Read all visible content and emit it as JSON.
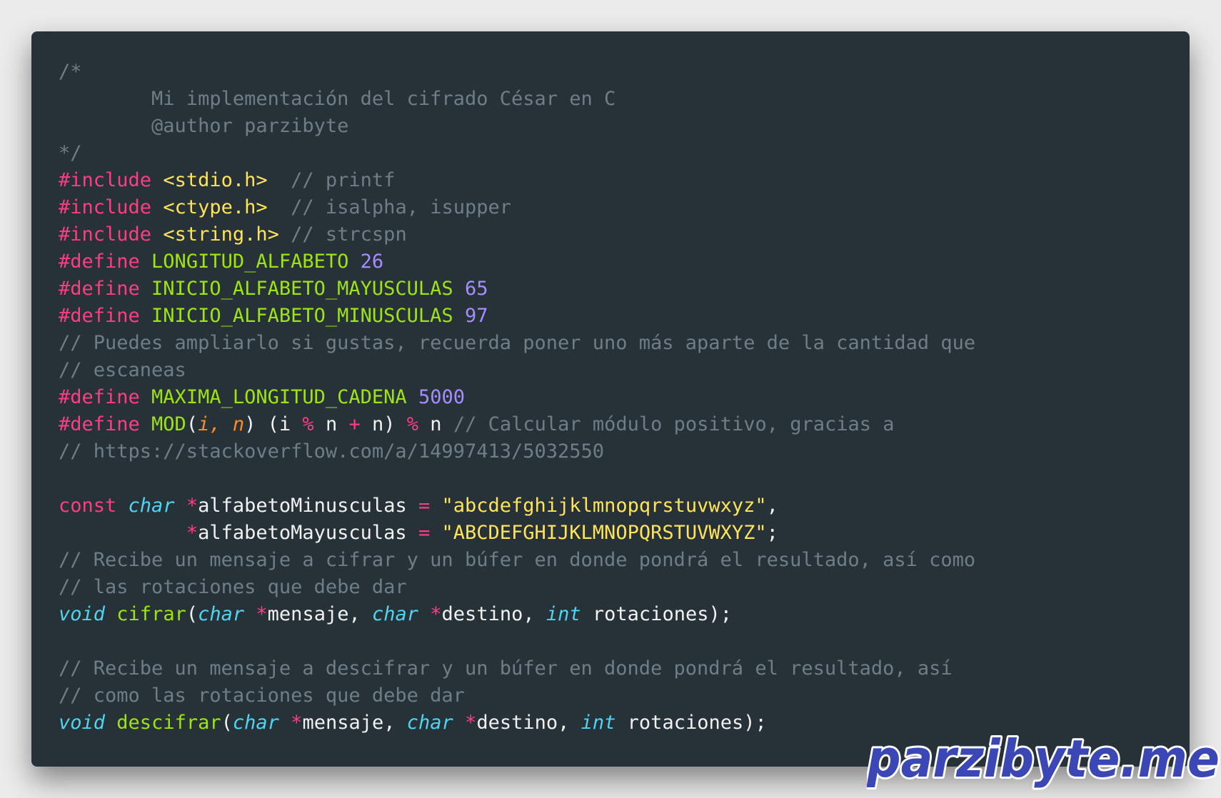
{
  "watermark": {
    "text": "parzibyte.me",
    "colors": {
      "fill": "#3a47b5",
      "stroke": "#ffffff"
    }
  },
  "editor": {
    "background": "#263238",
    "lines": [
      {
        "tokens": [
          {
            "t": "comment",
            "v": "/*"
          }
        ]
      },
      {
        "tokens": [
          {
            "t": "comment",
            "v": "        Mi implementación del cifrado César en C"
          }
        ]
      },
      {
        "tokens": [
          {
            "t": "comment",
            "v": "        @author parzibyte"
          }
        ]
      },
      {
        "tokens": [
          {
            "t": "comment",
            "v": "*/"
          }
        ]
      },
      {
        "tokens": [
          {
            "t": "preproc",
            "v": "#include "
          },
          {
            "t": "header",
            "v": "<stdio.h>"
          },
          {
            "t": "plain",
            "v": "  "
          },
          {
            "t": "comment",
            "v": "// printf"
          }
        ]
      },
      {
        "tokens": [
          {
            "t": "preproc",
            "v": "#include "
          },
          {
            "t": "header",
            "v": "<ctype.h>"
          },
          {
            "t": "plain",
            "v": "  "
          },
          {
            "t": "comment",
            "v": "// isalpha, isupper"
          }
        ]
      },
      {
        "tokens": [
          {
            "t": "preproc",
            "v": "#include "
          },
          {
            "t": "header",
            "v": "<string.h>"
          },
          {
            "t": "plain",
            "v": " "
          },
          {
            "t": "comment",
            "v": "// strcspn"
          }
        ]
      },
      {
        "tokens": [
          {
            "t": "preproc",
            "v": "#define "
          },
          {
            "t": "macro",
            "v": "LONGITUD_ALFABETO"
          },
          {
            "t": "plain",
            "v": " "
          },
          {
            "t": "number",
            "v": "26"
          }
        ]
      },
      {
        "tokens": [
          {
            "t": "preproc",
            "v": "#define "
          },
          {
            "t": "macro",
            "v": "INICIO_ALFABETO_MAYUSCULAS"
          },
          {
            "t": "plain",
            "v": " "
          },
          {
            "t": "number",
            "v": "65"
          }
        ]
      },
      {
        "tokens": [
          {
            "t": "preproc",
            "v": "#define "
          },
          {
            "t": "macro",
            "v": "INICIO_ALFABETO_MINUSCULAS"
          },
          {
            "t": "plain",
            "v": " "
          },
          {
            "t": "number",
            "v": "97"
          }
        ]
      },
      {
        "tokens": [
          {
            "t": "comment",
            "v": "// Puedes ampliarlo si gustas, recuerda poner uno más aparte de la cantidad que"
          }
        ]
      },
      {
        "tokens": [
          {
            "t": "comment",
            "v": "// escaneas"
          }
        ]
      },
      {
        "tokens": [
          {
            "t": "preproc",
            "v": "#define "
          },
          {
            "t": "macro",
            "v": "MAXIMA_LONGITUD_CADENA"
          },
          {
            "t": "plain",
            "v": " "
          },
          {
            "t": "number",
            "v": "5000"
          }
        ]
      },
      {
        "tokens": [
          {
            "t": "preproc",
            "v": "#define "
          },
          {
            "t": "macro",
            "v": "MOD"
          },
          {
            "t": "paren",
            "v": "("
          },
          {
            "t": "param",
            "v": "i, n"
          },
          {
            "t": "paren",
            "v": ")"
          },
          {
            "t": "plain",
            "v": " (i "
          },
          {
            "t": "op",
            "v": "%"
          },
          {
            "t": "plain",
            "v": " n "
          },
          {
            "t": "op",
            "v": "+"
          },
          {
            "t": "plain",
            "v": " n) "
          },
          {
            "t": "op",
            "v": "%"
          },
          {
            "t": "plain",
            "v": " n "
          },
          {
            "t": "comment",
            "v": "// Calcular módulo positivo, gracias a"
          }
        ]
      },
      {
        "tokens": [
          {
            "t": "comment",
            "v": "// https://stackoverflow.com/a/14997413/5032550"
          }
        ]
      },
      {
        "tokens": []
      },
      {
        "tokens": [
          {
            "t": "keyword",
            "v": "const"
          },
          {
            "t": "plain",
            "v": " "
          },
          {
            "t": "type",
            "v": "char"
          },
          {
            "t": "plain",
            "v": " "
          },
          {
            "t": "op",
            "v": "*"
          },
          {
            "t": "ident",
            "v": "alfabetoMinusculas"
          },
          {
            "t": "plain",
            "v": " "
          },
          {
            "t": "op",
            "v": "="
          },
          {
            "t": "plain",
            "v": " "
          },
          {
            "t": "string",
            "v": "\"abcdefghijklmnopqrstuvwxyz\""
          },
          {
            "t": "plain",
            "v": ","
          }
        ]
      },
      {
        "tokens": [
          {
            "t": "plain",
            "v": "           "
          },
          {
            "t": "op",
            "v": "*"
          },
          {
            "t": "ident",
            "v": "alfabetoMayusculas"
          },
          {
            "t": "plain",
            "v": " "
          },
          {
            "t": "op",
            "v": "="
          },
          {
            "t": "plain",
            "v": " "
          },
          {
            "t": "string",
            "v": "\"ABCDEFGHIJKLMNOPQRSTUVWXYZ\""
          },
          {
            "t": "plain",
            "v": ";"
          }
        ]
      },
      {
        "tokens": [
          {
            "t": "comment",
            "v": "// Recibe un mensaje a cifrar y un búfer en donde pondrá el resultado, así como"
          }
        ]
      },
      {
        "tokens": [
          {
            "t": "comment",
            "v": "// las rotaciones que debe dar"
          }
        ]
      },
      {
        "tokens": [
          {
            "t": "type",
            "v": "void"
          },
          {
            "t": "plain",
            "v": " "
          },
          {
            "t": "func",
            "v": "cifrar"
          },
          {
            "t": "paren",
            "v": "("
          },
          {
            "t": "type",
            "v": "char"
          },
          {
            "t": "plain",
            "v": " "
          },
          {
            "t": "op",
            "v": "*"
          },
          {
            "t": "ident",
            "v": "mensaje"
          },
          {
            "t": "plain",
            "v": ", "
          },
          {
            "t": "type",
            "v": "char"
          },
          {
            "t": "plain",
            "v": " "
          },
          {
            "t": "op",
            "v": "*"
          },
          {
            "t": "ident",
            "v": "destino"
          },
          {
            "t": "plain",
            "v": ", "
          },
          {
            "t": "type",
            "v": "int"
          },
          {
            "t": "plain",
            "v": " "
          },
          {
            "t": "ident",
            "v": "rotaciones"
          },
          {
            "t": "plain",
            "v": ");"
          }
        ]
      },
      {
        "tokens": []
      },
      {
        "tokens": [
          {
            "t": "comment",
            "v": "// Recibe un mensaje a descifrar y un búfer en donde pondrá el resultado, así"
          }
        ]
      },
      {
        "tokens": [
          {
            "t": "comment",
            "v": "// como las rotaciones que debe dar"
          }
        ]
      },
      {
        "tokens": [
          {
            "t": "type",
            "v": "void"
          },
          {
            "t": "plain",
            "v": " "
          },
          {
            "t": "func",
            "v": "descifrar"
          },
          {
            "t": "paren",
            "v": "("
          },
          {
            "t": "type",
            "v": "char"
          },
          {
            "t": "plain",
            "v": " "
          },
          {
            "t": "op",
            "v": "*"
          },
          {
            "t": "ident",
            "v": "mensaje"
          },
          {
            "t": "plain",
            "v": ", "
          },
          {
            "t": "type",
            "v": "char"
          },
          {
            "t": "plain",
            "v": " "
          },
          {
            "t": "op",
            "v": "*"
          },
          {
            "t": "ident",
            "v": "destino"
          },
          {
            "t": "plain",
            "v": ", "
          },
          {
            "t": "type",
            "v": "int"
          },
          {
            "t": "plain",
            "v": " "
          },
          {
            "t": "ident",
            "v": "rotaciones"
          },
          {
            "t": "plain",
            "v": ");"
          }
        ]
      }
    ]
  }
}
